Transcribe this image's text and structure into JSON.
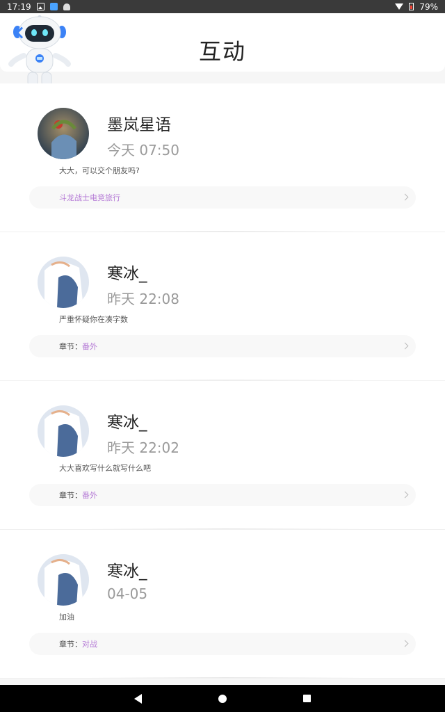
{
  "status_bar": {
    "time": "17:19",
    "battery": "79%",
    "icons": [
      "image-icon",
      "app-icon",
      "android-icon",
      "wifi-icon",
      "battery-icon"
    ]
  },
  "header": {
    "title": "互动",
    "back_icon": "back-arrow-icon",
    "mascot": "robot-mascot"
  },
  "colors": {
    "accent_link": "#b57ad6",
    "time_gray": "#9a9a9a"
  },
  "items": [
    {
      "username": "墨岚星语",
      "time": "今天 07:50",
      "comment": "大大，可以交个朋友吗?",
      "ref_prefix": "",
      "ref_link": "斗龙战士电竞旅行"
    },
    {
      "username": "寒冰_",
      "time": "昨天 22:08",
      "comment": "严重怀疑你在凑字数",
      "ref_prefix": "章节：",
      "ref_link": "番外"
    },
    {
      "username": "寒冰_",
      "time": "昨天 22:02",
      "comment": "大大喜欢写什么就写什么吧",
      "ref_prefix": "章节：",
      "ref_link": "番外"
    },
    {
      "username": "寒冰_",
      "time": "04-05",
      "comment": "加油",
      "ref_prefix": "章节：",
      "ref_link": "对战"
    }
  ]
}
